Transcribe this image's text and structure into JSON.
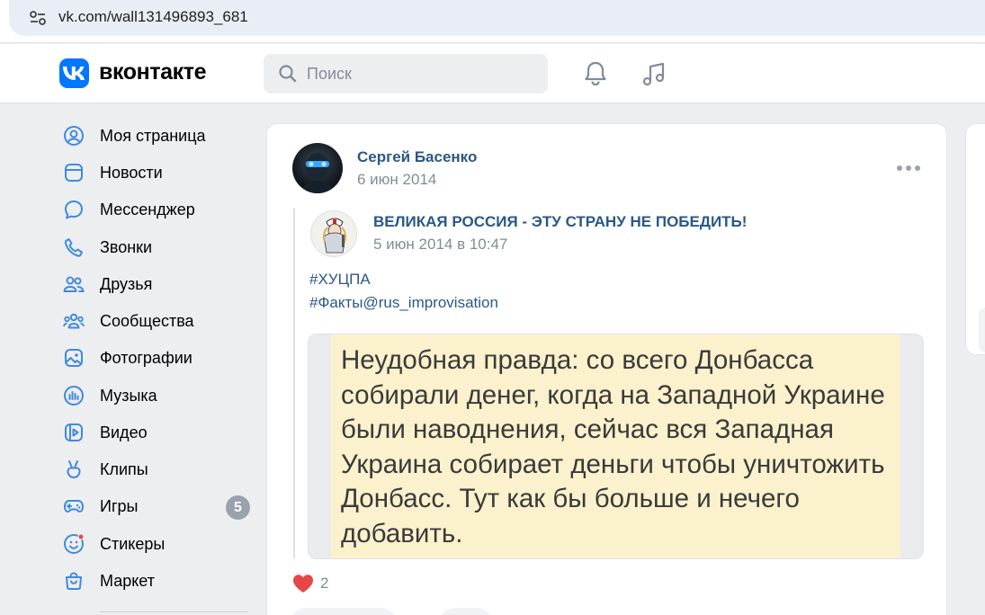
{
  "browser": {
    "url": "vk.com/wall131496893_681"
  },
  "header": {
    "logo_text": "вконтакте",
    "search_placeholder": "Поиск",
    "brand_color": "#0077ff"
  },
  "sidebar": {
    "items": [
      {
        "label": "Моя страница",
        "icon": "user-circle-icon"
      },
      {
        "label": "Новости",
        "icon": "news-icon"
      },
      {
        "label": "Мессенджер",
        "icon": "message-bubble-icon"
      },
      {
        "label": "Звонки",
        "icon": "phone-icon"
      },
      {
        "label": "Друзья",
        "icon": "friends-icon"
      },
      {
        "label": "Сообщества",
        "icon": "communities-icon"
      },
      {
        "label": "Фотографии",
        "icon": "photo-icon"
      },
      {
        "label": "Музыка",
        "icon": "music-bars-icon"
      },
      {
        "label": "Видео",
        "icon": "video-icon"
      },
      {
        "label": "Клипы",
        "icon": "clips-icon"
      },
      {
        "label": "Игры",
        "icon": "gamepad-icon",
        "badge": "5"
      },
      {
        "label": "Стикеры",
        "icon": "sticker-icon"
      },
      {
        "label": "Маркет",
        "icon": "shopping-bag-icon"
      }
    ]
  },
  "post": {
    "author": "Сергей Басенко",
    "date": "6 июн 2014",
    "repost": {
      "source": "ВЕЛИКАЯ РОССИЯ - ЭТУ СТРАНУ НЕ ПОБЕДИТЬ!",
      "date": "5 июн 2014 в 10:47"
    },
    "tags": [
      "#ХУЦПА",
      "#Факты@rus_improvisation"
    ],
    "image_text": "Неудобная правда: со всего Донбасса собирали денег, когда на Западной Украине были наводнения, сейчас вся Западная Украина собирает деньги чтобы уничтожить Донбасс. Тут как бы больше и нечего добавить.",
    "likes": "2"
  }
}
